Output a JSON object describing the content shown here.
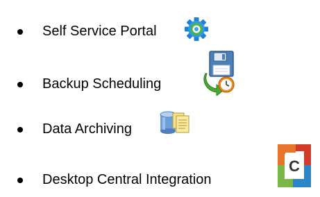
{
  "features": [
    {
      "label": "Self Service Portal",
      "icon": "gear-icon"
    },
    {
      "label": "Backup Scheduling",
      "icon": "backup-schedule-icon"
    },
    {
      "label": "Data Archiving",
      "icon": "data-archive-icon"
    },
    {
      "label": "Desktop Central Integration",
      "icon": "desktop-central-icon"
    }
  ],
  "colors": {
    "text": "#000000",
    "gear_blue": "#1f7fd6",
    "backup_green": "#4aa832",
    "archive_yellow": "#f2c94c",
    "dc_orange": "#e8732a",
    "dc_red": "#d23b2a",
    "dc_green": "#7ab648",
    "dc_blue": "#2b86c7"
  }
}
